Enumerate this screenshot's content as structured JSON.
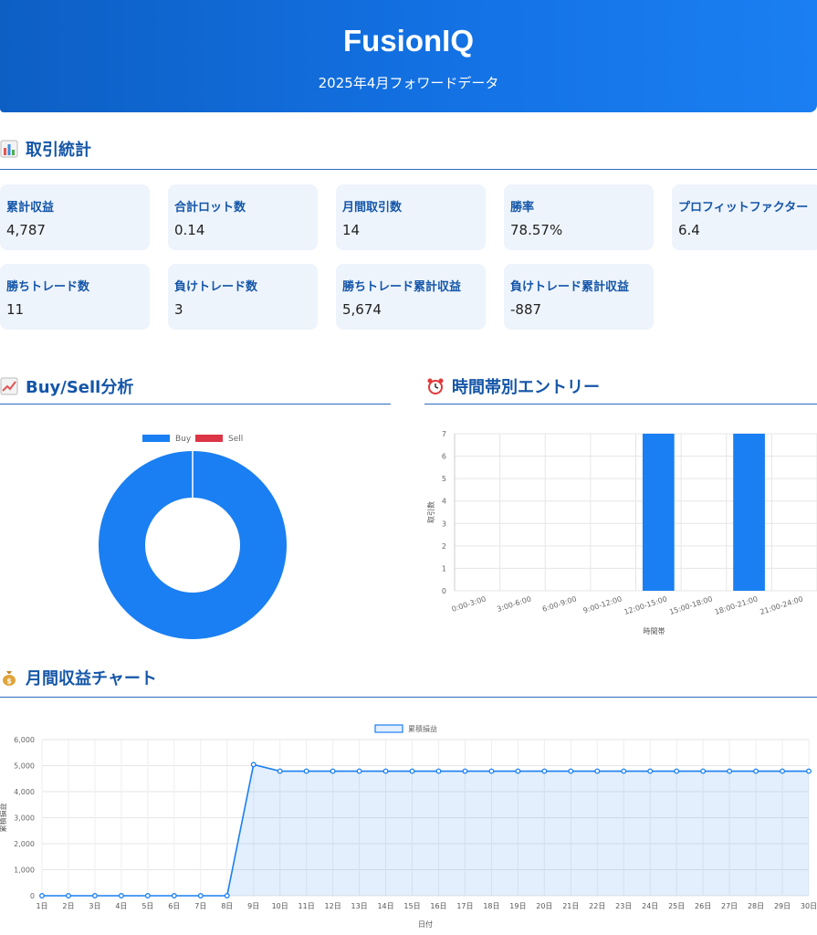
{
  "header": {
    "title": "FusionIQ",
    "subtitle": "2025年4月フォワードデータ"
  },
  "sections": {
    "stats": "取引統計",
    "buysell": "Buy/Sell分析",
    "time": "時間帯別エントリー",
    "monthly": "月間収益チャート"
  },
  "stats": [
    {
      "label": "累計収益",
      "value": "4,787"
    },
    {
      "label": "合計ロット数",
      "value": "0.14"
    },
    {
      "label": "月間取引数",
      "value": "14"
    },
    {
      "label": "勝率",
      "value": "78.57%"
    },
    {
      "label": "プロフィットファクター",
      "value": "6.4"
    },
    {
      "label": "勝ちトレード数",
      "value": "11"
    },
    {
      "label": "負けトレード数",
      "value": "3"
    },
    {
      "label": "勝ちトレード累計収益",
      "value": "5,674"
    },
    {
      "label": "負けトレード累計収益",
      "value": "-887"
    }
  ],
  "colors": {
    "buy": "#1a7ff2",
    "sell": "#dc3545",
    "accent": "#1456a8"
  },
  "chart_data": [
    {
      "type": "pie",
      "categories": [
        "Buy",
        "Sell"
      ],
      "values": [
        14,
        0
      ],
      "legend": "top"
    },
    {
      "type": "bar",
      "categories": [
        "0:00-3:00",
        "3:00-6:00",
        "6:00-9:00",
        "9:00-12:00",
        "12:00-15:00",
        "15:00-18:00",
        "18:00-21:00",
        "21:00-24:00"
      ],
      "values": [
        0,
        0,
        0,
        0,
        7,
        0,
        7,
        0
      ],
      "xlabel": "時間帯",
      "ylabel": "取引数",
      "ylim": [
        0,
        7
      ],
      "yticks": [
        0,
        1,
        2,
        3,
        4,
        5,
        6,
        7
      ],
      "grid": true
    },
    {
      "type": "area",
      "series": [
        {
          "name": "累積損益",
          "values": [
            0,
            0,
            0,
            0,
            0,
            0,
            0,
            0,
            5040,
            4787,
            4787,
            4787,
            4787,
            4787,
            4787,
            4787,
            4787,
            4787,
            4787,
            4787,
            4787,
            4787,
            4787,
            4787,
            4787,
            4787,
            4787,
            4787,
            4787,
            4787
          ]
        }
      ],
      "categories": [
        "1日",
        "2日",
        "3日",
        "4日",
        "5日",
        "6日",
        "7日",
        "8日",
        "9日",
        "10日",
        "11日",
        "12日",
        "13日",
        "14日",
        "15日",
        "16日",
        "17日",
        "18日",
        "19日",
        "20日",
        "21日",
        "22日",
        "23日",
        "24日",
        "25日",
        "26日",
        "27日",
        "28日",
        "29日",
        "30日"
      ],
      "xlabel": "日付",
      "ylabel": "累積損益",
      "ylim": [
        0,
        6000
      ],
      "yticks": [
        "0",
        "1,000",
        "2,000",
        "3,000",
        "4,000",
        "5,000",
        "6,000"
      ],
      "legend": "top",
      "grid": true
    }
  ]
}
